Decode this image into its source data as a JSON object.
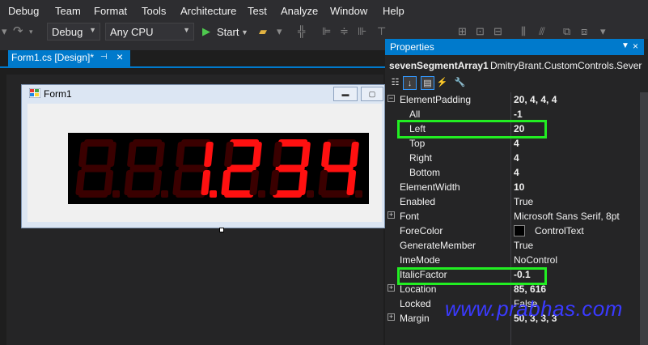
{
  "menu": [
    "Debug",
    "Team",
    "Format",
    "Tools",
    "Architecture",
    "Test",
    "Analyze",
    "Window",
    "Help"
  ],
  "toolbar": {
    "config": "Debug",
    "platform": "Any CPU",
    "start_label": "Start"
  },
  "document_tab": {
    "title": "Form1.cs [Design]*"
  },
  "form": {
    "title": "Form1"
  },
  "display": {
    "text": "1.234",
    "digit_count": 6,
    "on_color": "#ff1010",
    "off_color": "#3a0000"
  },
  "properties": {
    "title": "Properties",
    "object_name": "sevenSegmentArray1",
    "object_type": "DmitryBrant.CustomControls.Sever",
    "rows": [
      {
        "name": "ElementPadding",
        "value": "20, 4, 4, 4",
        "expand": "−",
        "indent": false,
        "bold": true
      },
      {
        "name": "All",
        "value": "-1",
        "expand": "",
        "indent": true,
        "bold": true
      },
      {
        "name": "Left",
        "value": "20",
        "expand": "",
        "indent": true,
        "bold": true
      },
      {
        "name": "Top",
        "value": "4",
        "expand": "",
        "indent": true,
        "bold": true
      },
      {
        "name": "Right",
        "value": "4",
        "expand": "",
        "indent": true,
        "bold": true
      },
      {
        "name": "Bottom",
        "value": "4",
        "expand": "",
        "indent": true,
        "bold": true
      },
      {
        "name": "ElementWidth",
        "value": "10",
        "expand": "",
        "indent": false,
        "bold": true
      },
      {
        "name": "Enabled",
        "value": "True",
        "expand": "",
        "indent": false,
        "bold": false
      },
      {
        "name": "Font",
        "value": "Microsoft Sans Serif, 8pt",
        "expand": "+",
        "indent": false,
        "bold": false
      },
      {
        "name": "ForeColor",
        "value": "ControlText",
        "expand": "",
        "indent": false,
        "bold": false,
        "swatch": "#000000"
      },
      {
        "name": "GenerateMember",
        "value": "True",
        "expand": "",
        "indent": false,
        "bold": false
      },
      {
        "name": "ImeMode",
        "value": "NoControl",
        "expand": "",
        "indent": false,
        "bold": false
      },
      {
        "name": "ItalicFactor",
        "value": "-0.1",
        "expand": "",
        "indent": false,
        "bold": true
      },
      {
        "name": "Location",
        "value": "85, 616",
        "expand": "+",
        "indent": false,
        "bold": true
      },
      {
        "name": "Locked",
        "value": "False",
        "expand": "",
        "indent": false,
        "bold": false
      },
      {
        "name": "Margin",
        "value": "50, 3, 3, 3",
        "expand": "+",
        "indent": false,
        "bold": true
      }
    ]
  },
  "highlight_color": "#22ee22",
  "watermark": "www.prabhas.com"
}
